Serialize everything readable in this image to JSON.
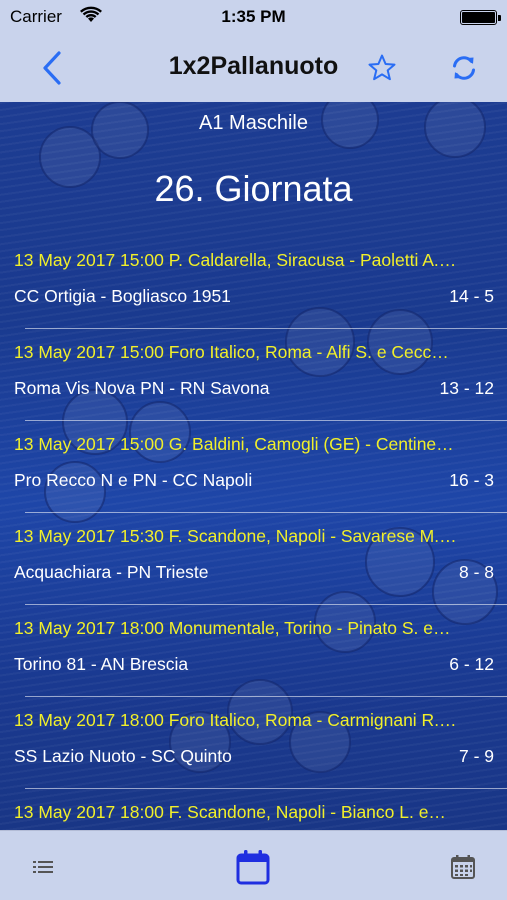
{
  "status_bar": {
    "carrier": "Carrier",
    "time": "1:35 PM"
  },
  "nav": {
    "title": "1x2Pallanuoto",
    "back_icon": "chevron-left-icon",
    "favorite_icon": "star-outline-icon",
    "refresh_icon": "refresh-icon",
    "accent_color": "#2a6df4"
  },
  "league": "A1 Maschile",
  "round": "26. Giornata",
  "matches": [
    {
      "info": "13 May 2017 15:00 P. Caldarella, Siracusa - Paoletti A.…",
      "teams": "CC Ortigia - Bogliasco 1951",
      "score": "14 - 5"
    },
    {
      "info": "13 May 2017 15:00 Foro Italico, Roma - Alfi S. e Cecc…",
      "teams": "Roma Vis Nova PN - RN Savona",
      "score": "13 - 12"
    },
    {
      "info": "13 May 2017 15:00 G. Baldini, Camogli (GE) - Centine…",
      "teams": "Pro Recco N e PN - CC Napoli",
      "score": "16 - 3"
    },
    {
      "info": "13 May 2017 15:30 F. Scandone, Napoli - Savarese M.…",
      "teams": "Acquachiara - PN Trieste",
      "score": "8 - 8"
    },
    {
      "info": "13 May 2017 18:00 Monumentale, Torino - Pinato S. e…",
      "teams": "Torino 81 - AN Brescia",
      "score": "6 - 12"
    },
    {
      "info": "13 May 2017 18:00 Foro Italico, Roma - Carmignani R.…",
      "teams": "SS Lazio Nuoto - SC Quinto",
      "score": "7 - 9"
    },
    {
      "info": "13 May 2017 18:00 F. Scandone, Napoli - Bianco L. e…",
      "teams": "",
      "score": ""
    }
  ],
  "colors": {
    "info_text": "#f1ef2a",
    "bar_background": "#c9d3ec",
    "content_background": "#1b3a8a"
  },
  "tabbar": {
    "items": [
      {
        "icon": "list-icon",
        "selected": false
      },
      {
        "icon": "calendar-icon",
        "selected": true
      },
      {
        "icon": "calendar-grid-icon",
        "selected": false
      }
    ]
  }
}
